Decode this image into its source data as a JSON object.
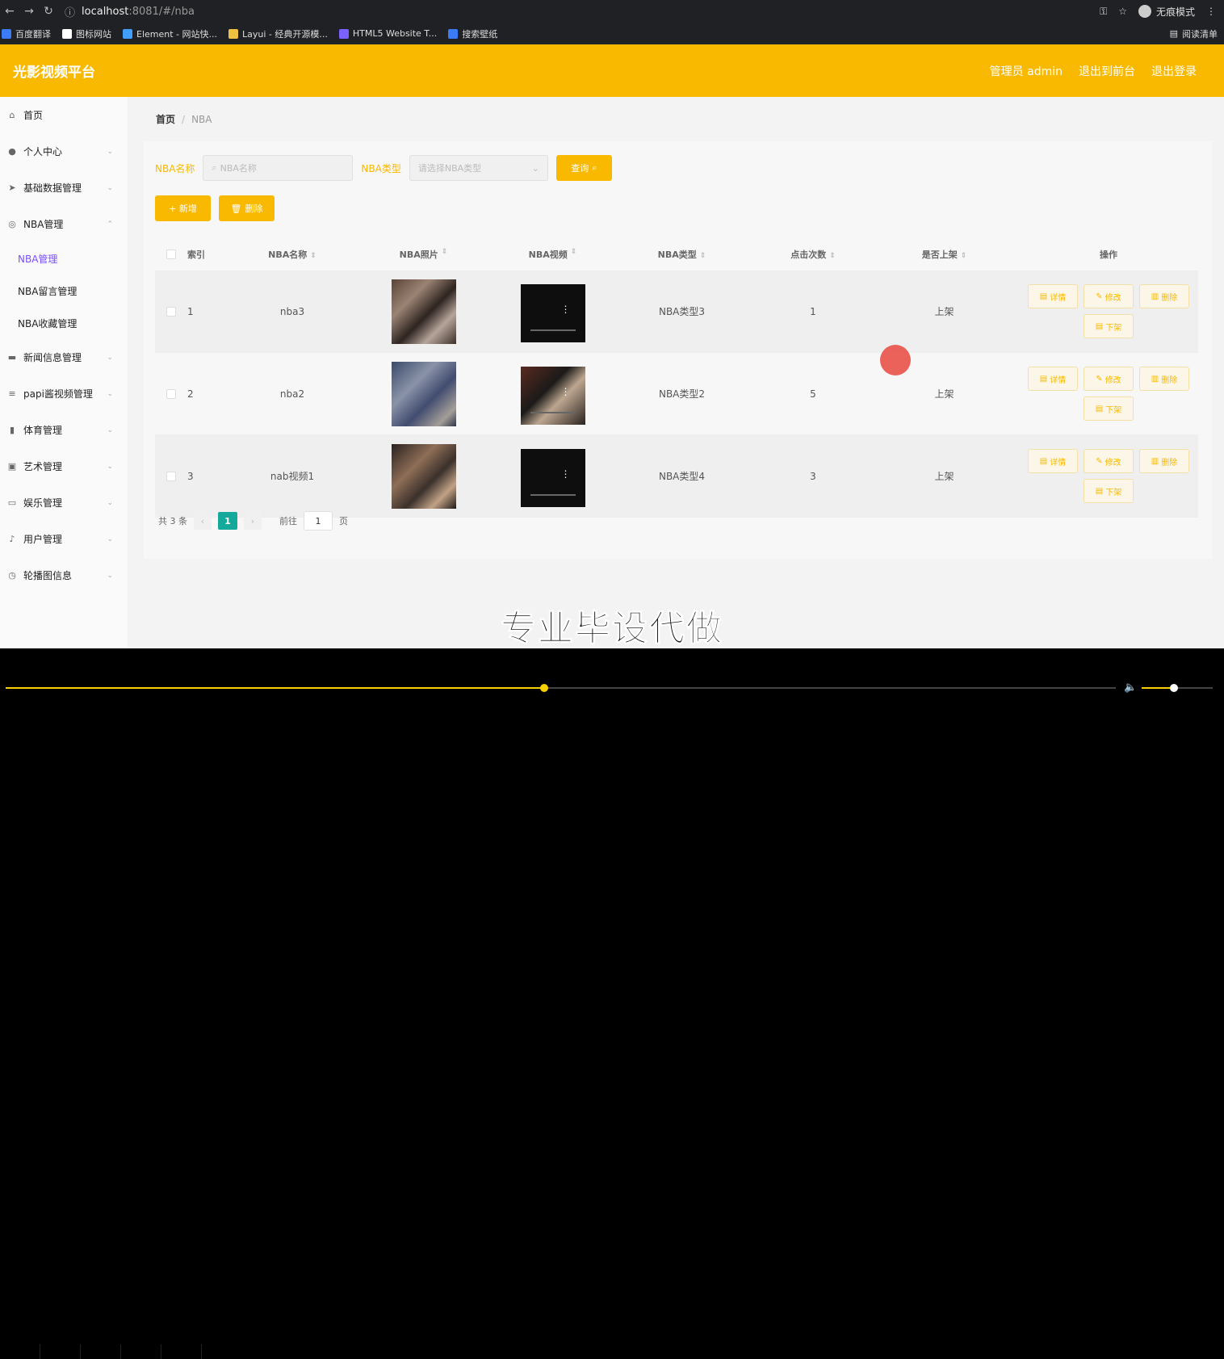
{
  "browser": {
    "url_host": "localhost",
    "url_path": ":8081/#/nba",
    "incognito_label": "无痕模式",
    "bookmarks": [
      {
        "label": "百度翻译",
        "color": "#3b7bf5"
      },
      {
        "label": "图标网站",
        "color": "#ffffff"
      },
      {
        "label": "Element - 网站快...",
        "color": "#409eff"
      },
      {
        "label": "Layui - 经典开源模...",
        "color": "#f0c040"
      },
      {
        "label": "HTML5 Website T...",
        "color": "#7b61ff"
      },
      {
        "label": "搜索壁纸",
        "color": "#3b7bf5"
      }
    ],
    "reading_list": "阅读清单"
  },
  "header": {
    "brand": "光影视频平台",
    "admin": "管理员 admin",
    "to_front": "退出到前台",
    "logout": "退出登录",
    "color": "#f8b900"
  },
  "sidebar": {
    "items": [
      {
        "label": "首页",
        "icon": "home-icon",
        "glyph": "⌂"
      },
      {
        "label": "个人中心",
        "icon": "user-icon",
        "glyph": "●"
      },
      {
        "label": "基础数据管理",
        "icon": "send-icon",
        "glyph": "➤"
      },
      {
        "label": "NBA管理",
        "icon": "circle-icon",
        "glyph": "◎"
      },
      {
        "label": "新闻信息管理",
        "icon": "chat-icon",
        "glyph": "▬"
      },
      {
        "label": "papi酱视频管理",
        "icon": "menu-icon",
        "glyph": "≡"
      },
      {
        "label": "体育管理",
        "icon": "chart-icon",
        "glyph": "▮"
      },
      {
        "label": "艺术管理",
        "icon": "check-icon",
        "glyph": "▣"
      },
      {
        "label": "娱乐管理",
        "icon": "message-icon",
        "glyph": "▭"
      },
      {
        "label": "用户管理",
        "icon": "mic-icon",
        "glyph": "♪"
      },
      {
        "label": "轮播图信息",
        "icon": "clock-icon",
        "glyph": "◷"
      }
    ],
    "sub_items": [
      "NBA管理",
      "NBA留言管理",
      "NBA收藏管理"
    ]
  },
  "breadcrumb": {
    "home": "首页",
    "current": "NBA"
  },
  "search": {
    "name_label": "NBA名称",
    "name_placeholder": "NBA名称",
    "type_label": "NBA类型",
    "type_placeholder": "请选择NBA类型",
    "query_button": "查询"
  },
  "actions": {
    "add": "+ 新增",
    "delete": "删除"
  },
  "table": {
    "headers": [
      "索引",
      "NBA名称",
      "NBA照片",
      "NBA视频",
      "NBA类型",
      "点击次数",
      "是否上架",
      "操作"
    ],
    "rows": [
      {
        "index": "1",
        "name": "nba3",
        "type": "NBA类型3",
        "clicks": "1",
        "shelf": "上架"
      },
      {
        "index": "2",
        "name": "nba2",
        "type": "NBA类型2",
        "clicks": "5",
        "shelf": "上架"
      },
      {
        "index": "3",
        "name": "nab视频1",
        "type": "NBA类型4",
        "clicks": "3",
        "shelf": "上架"
      }
    ],
    "ops": {
      "detail": "详情",
      "edit": "修改",
      "remove": "删除",
      "unshelf": "下架"
    }
  },
  "pagination": {
    "total": "共 3 条",
    "current": "1",
    "goto": "前往",
    "page_input": "1",
    "page_suffix": "页"
  },
  "watermark": "专业毕设代做",
  "player": {
    "progress": 0.485,
    "volume": 0.45
  }
}
